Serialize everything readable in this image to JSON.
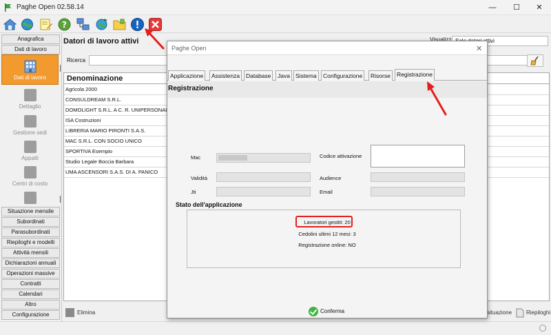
{
  "window": {
    "title": "Paghe Open 02.58.14",
    "minimize_glyph": "—",
    "maximize_glyph": "☐",
    "close_glyph": "✕"
  },
  "toolbar": {
    "icons": [
      "home-icon",
      "globe-icon",
      "notes-icon",
      "help-icon",
      "network-icon",
      "refresh-globe-icon",
      "folder-icon",
      "info-icon",
      "exit-icon"
    ]
  },
  "sidebar": {
    "top_buttons": [
      "Anagrafica",
      "Dati di lavoro"
    ],
    "active_item": "Dati di lavoro",
    "items": [
      "Dettaglio",
      "Gestione sedi",
      "Appalti",
      "Centri di costo"
    ],
    "bottom_buttons": [
      "Situazione mensile",
      "Subordinati",
      "Parasubordinati",
      "Riepiloghi e modelli",
      "Attività mensili",
      "Dichiarazioni annuali",
      "Operazioni massive",
      "Contratti",
      "Calendari",
      "Altro",
      "Configurazione"
    ]
  },
  "main": {
    "title": "Datori di lavoro attivi",
    "visualizza_label": "Visualizza",
    "visualizza_value": "Solo datori attivi",
    "search_label": "Ricerca",
    "search_value": "",
    "table_header": "Denominazione",
    "rows": [
      "Agricola 2000",
      "CONSULDREAM S.R.L.",
      "DOMOLIGHT S.R.L. A C. R. UNIPERSONALE",
      "ISA Costruzioni",
      "LIBRERIA MARIO PIRONTI S.A.S.",
      "MAC S.R.L. CON SOCIO UNICO",
      "SPORTIVA Esempio",
      "Studio Legale Boccia Barbara",
      "UMA ASCENSORI S.A.S. DI A. PANICO"
    ],
    "delete_label": "Elimina",
    "situazione_label": "situazione",
    "riepiloghi_label": "Riepiloghi"
  },
  "dialog": {
    "title": "Paghe Open",
    "close_glyph": "✕",
    "tabs": [
      "Applicazione",
      "Assistenza",
      "Database",
      "Java",
      "Sistema",
      "Configurazione",
      "Risorse",
      "Registrazione"
    ],
    "active_tab": "Registrazione",
    "section_title": "Registrazione",
    "fields": {
      "mac_label": "Mac",
      "mac_value": "",
      "codice_label": "Codice attivazione",
      "codice_value": "",
      "validita_label": "Validità",
      "validita_value": "",
      "audience_label": "Audience",
      "audience_value": "",
      "jti_label": "Jti",
      "jti_value": "",
      "email_label": "Email",
      "email_value": ""
    },
    "status": {
      "title": "Stato dell'applicazione",
      "lavoratori": "Lavoratori gestiti: 20",
      "cedolini": "Cedolini ultimi 12 mesi: 3",
      "registrazione": "Registrazione online: NO"
    },
    "confirm_label": "Conferma"
  },
  "colors": {
    "active_sidebar": "#f39a2e",
    "annotation_red": "#e41d1d",
    "confirm_green": "#3db63d"
  }
}
